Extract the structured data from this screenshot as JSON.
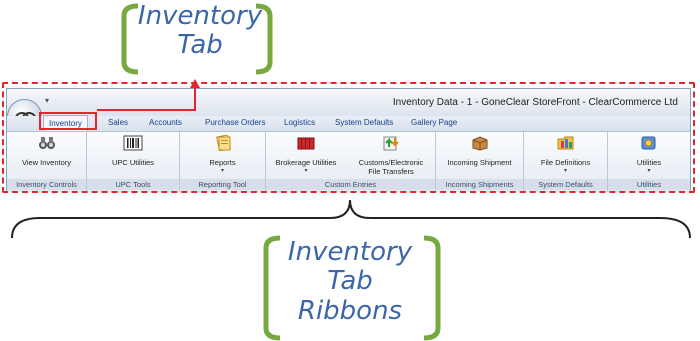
{
  "callouts": {
    "top": {
      "line1": "Inventory",
      "line2": "Tab"
    },
    "bottom": {
      "line1": "Inventory",
      "line2": "Tab",
      "line3": "Ribbons"
    }
  },
  "window": {
    "title": "Inventory Data - 1 - GoneClear StoreFront - ClearCommerce Ltd"
  },
  "tabs": [
    {
      "label": "Inventory",
      "active": true
    },
    {
      "label": "Sales"
    },
    {
      "label": "Accounts"
    },
    {
      "label": "Purchase Orders"
    },
    {
      "label": "Logistics"
    },
    {
      "label": "System Defaults"
    },
    {
      "label": "Gallery Page"
    }
  ],
  "groups": [
    {
      "label": "Inventory Controls",
      "button": "View Inventory",
      "icon": "binoculars-icon",
      "dropdown": false
    },
    {
      "label": "UPC Tools",
      "button": "UPC Utilities",
      "icon": "barcode-icon",
      "dropdown": false
    },
    {
      "label": "Reporting Tool",
      "button": "Reports",
      "icon": "reports-icon",
      "dropdown": true
    },
    {
      "label": "Custom Entries",
      "button": "Brokerage Utilities",
      "icon": "container-icon",
      "dropdown": true
    },
    {
      "label": "",
      "button": "Customs/Electronic File Transfers",
      "button_line1": "Customs/Electronic",
      "button_line2": "File Transfers",
      "icon": "transfer-icon",
      "dropdown": false
    },
    {
      "label": "Incoming Shipments",
      "button": "Incoming Shipment",
      "icon": "package-icon",
      "dropdown": false
    },
    {
      "label": "System Defaults",
      "button": "File Definitions",
      "icon": "folder-icon",
      "dropdown": true
    },
    {
      "label": "Utilities",
      "button": "Utilities",
      "icon": "utilities-icon",
      "dropdown": true
    }
  ],
  "colors": {
    "callout_text": "#3b66a8",
    "bracket": "#77a93f",
    "highlight": "#e3262b"
  }
}
